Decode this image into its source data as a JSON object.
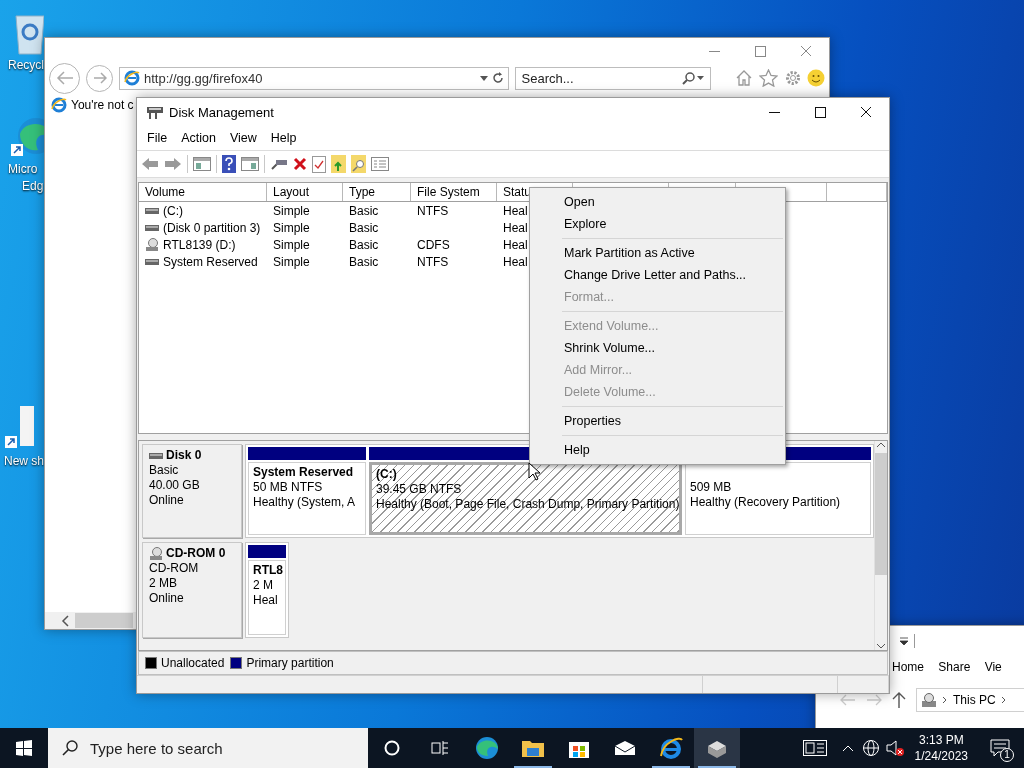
{
  "desktop_icons": [
    {
      "kind": "recycle",
      "lines": [
        "Recycl"
      ]
    },
    {
      "kind": "edge",
      "lines": [
        "Micro",
        "Edg"
      ]
    },
    {
      "kind": "shortcut",
      "lines": [
        "New sh"
      ]
    }
  ],
  "browser": {
    "address": "http://gg.gg/firefox40",
    "search": {
      "placeholder": "Search..."
    },
    "tab": "You're not c"
  },
  "disk_management": {
    "title": "Disk Management",
    "menu": [
      "File",
      "Action",
      "View",
      "Help"
    ],
    "volume_list": {
      "columns": [
        "Volume",
        "Layout",
        "Type",
        "File System",
        "Statu"
      ],
      "rows": [
        {
          "kind": "disk",
          "cells": [
            "(C:)",
            "Simple",
            "Basic",
            "NTFS",
            "Heal"
          ]
        },
        {
          "kind": "disk",
          "cells": [
            "(Disk 0 partition 3)",
            "Simple",
            "Basic",
            "",
            "Heal"
          ]
        },
        {
          "kind": "cdrom",
          "cells": [
            "RTL8139 (D:)",
            "Simple",
            "Basic",
            "CDFS",
            "Heal"
          ]
        },
        {
          "kind": "disk",
          "cells": [
            "System Reserved",
            "Simple",
            "Basic",
            "NTFS",
            "Heal"
          ]
        }
      ]
    },
    "disks": [
      {
        "kind": "disk",
        "name": "Disk 0",
        "details": [
          "Basic",
          "40.00 GB",
          "Online"
        ],
        "partitions": [
          {
            "title": "System Reserved",
            "size": "50 MB NTFS",
            "status": "Healthy (System, A",
            "selected": false
          },
          {
            "title": "(C:)",
            "size": "39.45 GB NTFS",
            "status": "Healthy (Boot, Page File, Crash Dump, Primary Partition)",
            "selected": true
          },
          {
            "size": "509 MB",
            "status": "Healthy (Recovery Partition)",
            "selected": false
          }
        ]
      },
      {
        "kind": "cdrom",
        "name": "CD-ROM 0",
        "details": [
          "CD-ROM",
          "2 MB",
          "Online"
        ],
        "partitions": [
          {
            "title": "RTL8",
            "size": "2 M",
            "status": "Heal",
            "selected": false
          }
        ]
      }
    ],
    "legend": [
      {
        "label": "Unallocated",
        "color": "#000000"
      },
      {
        "label": "Primary partition",
        "color": "#000080"
      }
    ]
  },
  "context_menu": {
    "groups": [
      [
        {
          "label": "Open",
          "disabled": false
        },
        {
          "label": "Explore",
          "disabled": false
        }
      ],
      [
        {
          "label": "Mark Partition as Active",
          "disabled": false
        },
        {
          "label": "Change Drive Letter and Paths...",
          "disabled": false
        },
        {
          "label": "Format...",
          "disabled": true
        }
      ],
      [
        {
          "label": "Extend Volume...",
          "disabled": true
        },
        {
          "label": "Shrink Volume...",
          "disabled": false
        },
        {
          "label": "Add Mirror...",
          "disabled": true
        },
        {
          "label": "Delete Volume...",
          "disabled": true
        }
      ],
      [
        {
          "label": "Properties",
          "disabled": false
        }
      ],
      [
        {
          "label": "Help",
          "disabled": false
        }
      ]
    ]
  },
  "explorer": {
    "ribbon_tabs": [
      "Home",
      "Share",
      "Vie"
    ],
    "address": "This PC"
  },
  "taskbar": {
    "search": {
      "placeholder": "Type here to search"
    },
    "time": "3:13 PM",
    "date": "1/24/2023",
    "notification_count": "1"
  }
}
